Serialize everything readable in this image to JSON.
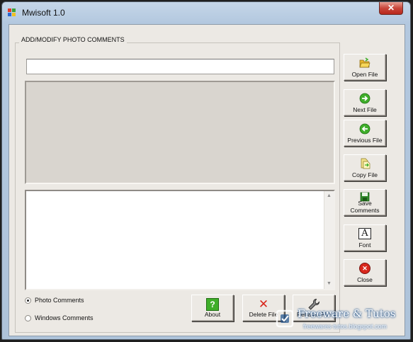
{
  "window": {
    "title": "Mwisoft 1.0",
    "close_glyph": "✕"
  },
  "group": {
    "label": "ADD/MODIFY PHOTO COMMENTS"
  },
  "path_input": {
    "value": "",
    "placeholder": ""
  },
  "comments_text": "",
  "side_buttons": {
    "open_file": {
      "label": "Open File",
      "icon": "folder-open-icon"
    },
    "next_file": {
      "label": "Next File",
      "icon": "arrow-right-icon"
    },
    "previous_file": {
      "label": "Previous File",
      "icon": "arrow-left-icon"
    },
    "copy_file": {
      "label": "Copy File",
      "icon": "copy-file-icon"
    },
    "save_comments": {
      "line1": "Save",
      "line2": "Comments",
      "icon": "save-disk-icon"
    },
    "font": {
      "label": "Font",
      "icon": "font-letter-icon",
      "glyph": "A"
    },
    "close": {
      "label": "Close",
      "icon": "close-circle-icon",
      "glyph": "✕"
    }
  },
  "bottom_buttons": {
    "about": {
      "label": "About",
      "icon": "help-question-icon",
      "glyph": "?"
    },
    "delete_file": {
      "label": "Delete File",
      "icon": "delete-x-icon",
      "glyph": "✕"
    },
    "rename_file": {
      "label": "Rename File",
      "icon": "wrench-icon"
    }
  },
  "radio_options": {
    "photo_comments": {
      "label": "Photo Comments",
      "selected": true
    },
    "windows_comments": {
      "label": "Windows Comments",
      "selected": false
    }
  },
  "scrollbar": {
    "up": "▲",
    "down": "▼"
  },
  "watermark": {
    "title": "Freeware & Tutos",
    "url": "freewares-tutos.blogspot.com"
  },
  "colors": {
    "title_bar": "#b3c8df",
    "client_bg": "#ece9e4",
    "close_red": "#c9463a",
    "icon_green": "#3fae2a",
    "icon_red": "#d9271c",
    "watermark_blue": "#1b4f8a"
  }
}
